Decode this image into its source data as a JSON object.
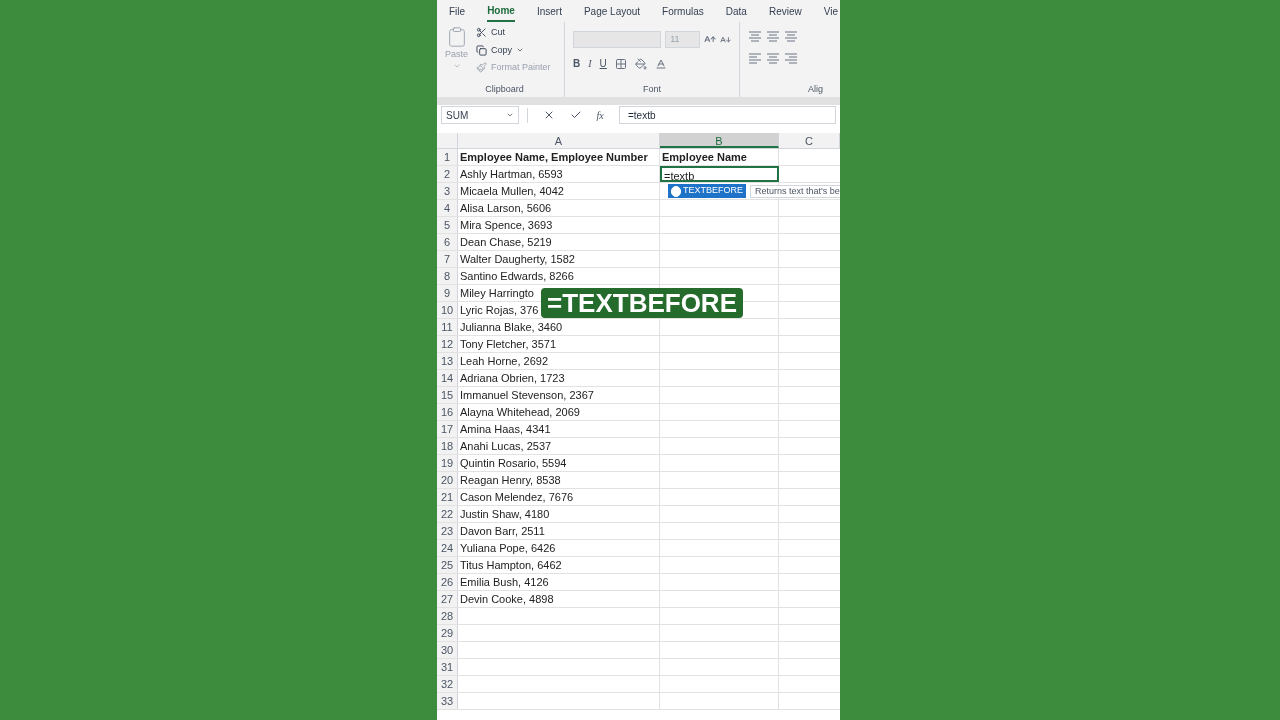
{
  "ribbon": {
    "tabs": [
      {
        "label": "File",
        "selected": false
      },
      {
        "label": "Home",
        "selected": true
      },
      {
        "label": "Insert",
        "selected": false
      },
      {
        "label": "Page Layout",
        "selected": false
      },
      {
        "label": "Formulas",
        "selected": false
      },
      {
        "label": "Data",
        "selected": false
      },
      {
        "label": "Review",
        "selected": false
      },
      {
        "label": "Vie",
        "selected": false
      }
    ],
    "clipboard": {
      "paste": "Paste",
      "cut": "Cut",
      "copy": "Copy",
      "format_painter": "Format Painter",
      "label": "Clipboard"
    },
    "font": {
      "size": "11",
      "bold": "B",
      "italic": "I",
      "underline": "U",
      "label": "Font"
    },
    "alignment": {
      "label": "Alig"
    }
  },
  "formula_bar": {
    "name_box": "SUM",
    "fx": "fx",
    "formula": "=textb"
  },
  "columns": [
    {
      "label": "A",
      "selected": false
    },
    {
      "label": "B",
      "selected": true
    },
    {
      "label": "C",
      "selected": false
    }
  ],
  "rows": [
    {
      "number": "1",
      "kind": "header",
      "a": "Employee Name, Employee Number",
      "b": "Employee Name",
      "editing": false
    },
    {
      "number": "2",
      "kind": "data",
      "a": "Ashly Hartman, 6593",
      "b": "=textb",
      "editing": true
    },
    {
      "number": "3",
      "kind": "data",
      "a": "Micaela Mullen, 4042",
      "editing": false
    },
    {
      "number": "4",
      "kind": "data",
      "a": "Alisa Larson, 5606",
      "editing": false
    },
    {
      "number": "5",
      "kind": "data",
      "a": "Mira Spence, 3693",
      "editing": false
    },
    {
      "number": "6",
      "kind": "data",
      "a": "Dean Chase, 5219",
      "editing": false
    },
    {
      "number": "7",
      "kind": "data",
      "a": "Walter Daugherty, 1582",
      "editing": false
    },
    {
      "number": "8",
      "kind": "data",
      "a": "Santino Edwards, 8266",
      "editing": false
    },
    {
      "number": "9",
      "kind": "data",
      "a": "Miley Harringto",
      "editing": false
    },
    {
      "number": "10",
      "kind": "data",
      "a": "Lyric Rojas, 376",
      "editing": false
    },
    {
      "number": "11",
      "kind": "data",
      "a": "Julianna Blake, 3460",
      "editing": false
    },
    {
      "number": "12",
      "kind": "data",
      "a": "Tony Fletcher, 3571",
      "editing": false
    },
    {
      "number": "13",
      "kind": "data",
      "a": "Leah Horne, 2692",
      "editing": false
    },
    {
      "number": "14",
      "kind": "data",
      "a": "Adriana Obrien, 1723",
      "editing": false
    },
    {
      "number": "15",
      "kind": "data",
      "a": "Immanuel Stevenson, 2367",
      "editing": false
    },
    {
      "number": "16",
      "kind": "data",
      "a": "Alayna Whitehead, 2069",
      "editing": false
    },
    {
      "number": "17",
      "kind": "data",
      "a": "Amina Haas, 4341",
      "editing": false
    },
    {
      "number": "18",
      "kind": "data",
      "a": "Anahi Lucas, 2537",
      "editing": false
    },
    {
      "number": "19",
      "kind": "data",
      "a": "Quintin Rosario, 5594",
      "editing": false
    },
    {
      "number": "20",
      "kind": "data",
      "a": "Reagan Henry, 8538",
      "editing": false
    },
    {
      "number": "21",
      "kind": "data",
      "a": "Cason Melendez, 7676",
      "editing": false
    },
    {
      "number": "22",
      "kind": "data",
      "a": "Justin Shaw, 4180",
      "editing": false
    },
    {
      "number": "23",
      "kind": "data",
      "a": "Davon Barr, 2511",
      "editing": false
    },
    {
      "number": "24",
      "kind": "data",
      "a": "Yuliana Pope, 6426",
      "editing": false
    },
    {
      "number": "25",
      "kind": "data",
      "a": "Titus Hampton, 6462",
      "editing": false
    },
    {
      "number": "26",
      "kind": "data",
      "a": "Emilia Bush, 4126",
      "editing": false
    },
    {
      "number": "27",
      "kind": "data",
      "a": "Devin Cooke, 4898",
      "editing": false
    },
    {
      "number": "28",
      "kind": "data",
      "editing": false
    },
    {
      "number": "29",
      "kind": "data",
      "editing": false
    },
    {
      "number": "30",
      "kind": "data",
      "editing": false
    },
    {
      "number": "31",
      "kind": "data",
      "editing": false
    },
    {
      "number": "32",
      "kind": "data",
      "editing": false
    },
    {
      "number": "33",
      "kind": "data",
      "editing": false
    }
  ],
  "autocomplete": {
    "item": "TEXTBEFORE",
    "tooltip": "Returns text that's be"
  },
  "caption": "=TEXTBEFORE"
}
